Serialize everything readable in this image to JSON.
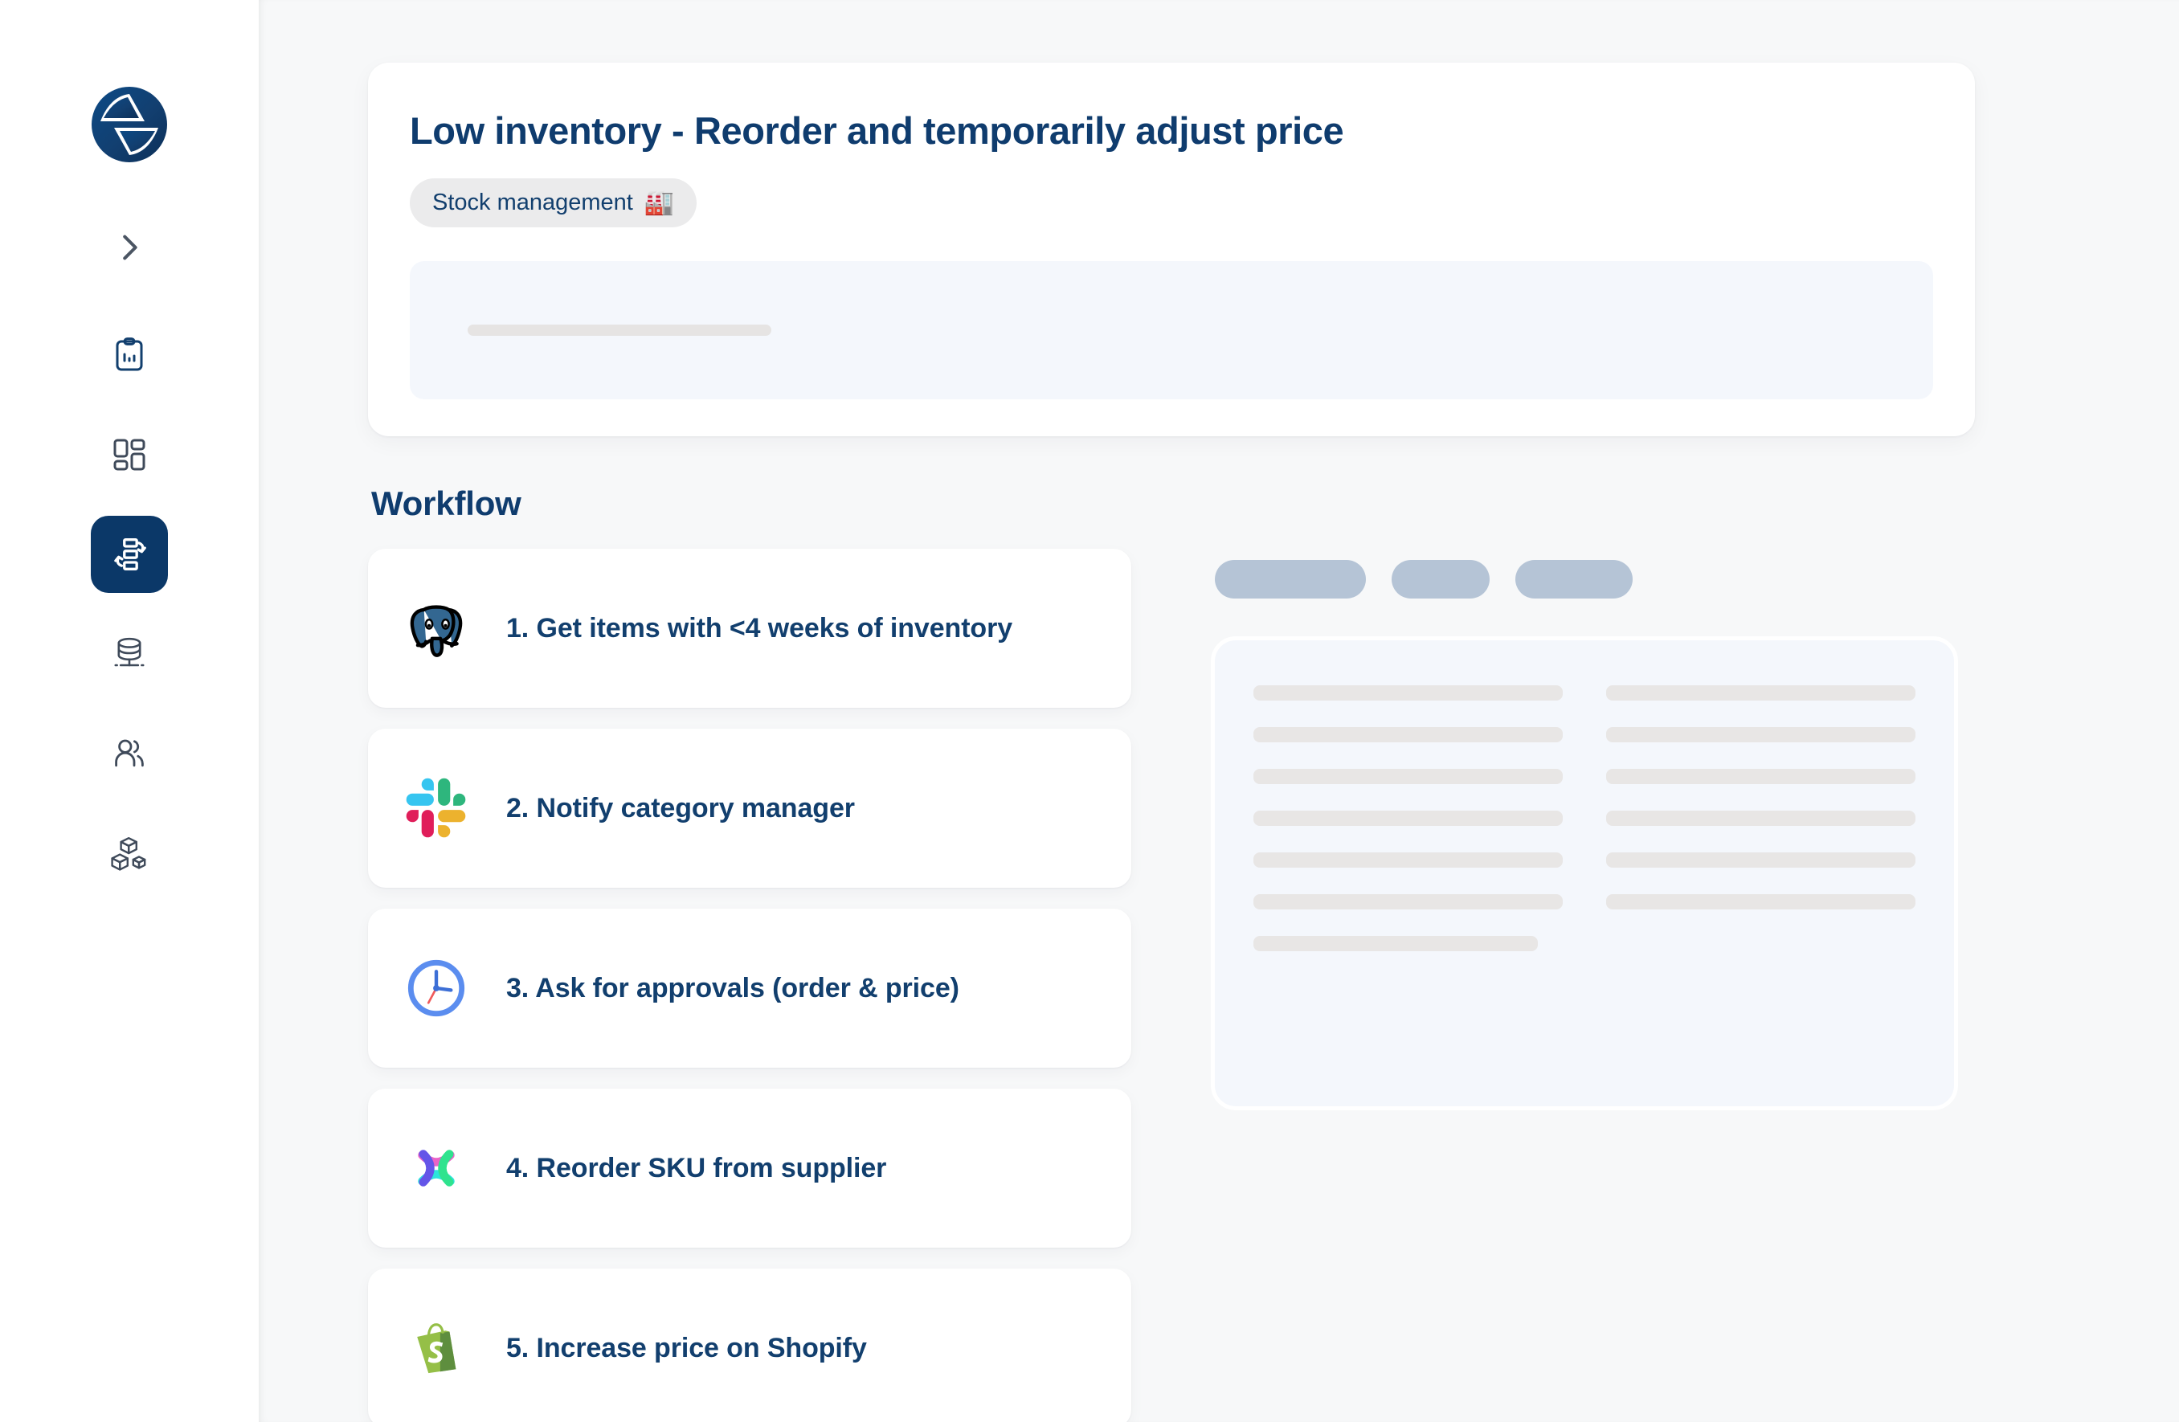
{
  "theme": {
    "brand_navy": "#0b3868",
    "text_navy": "#123f6e",
    "page_bg": "#f7f8f9",
    "card_bg": "#ffffff",
    "skeleton_panel_bg": "#f4f7fc",
    "skeleton_bar": "#e8e6e5",
    "pill_bg": "#ebebec",
    "preview_pill": "#b5c4d6"
  },
  "sidebar": {
    "logo_name": "company-logo",
    "expand": {
      "icon": "chevron-right-icon",
      "label": "Expand navigation"
    },
    "items": [
      {
        "icon": "clipboard-report-icon",
        "name": "reports",
        "active": false
      },
      {
        "icon": "dashboard-grid-icon",
        "name": "dashboards",
        "active": false
      },
      {
        "icon": "workflow-icon",
        "name": "workflows",
        "active": true
      },
      {
        "icon": "database-icon",
        "name": "data",
        "active": false
      },
      {
        "icon": "users-icon",
        "name": "team",
        "active": false
      },
      {
        "icon": "boxes-icon",
        "name": "products",
        "active": false
      }
    ]
  },
  "header": {
    "title": "Low inventory - Reorder and temporarily adjust price",
    "tag": {
      "label": "Stock management",
      "emoji": "🏭"
    }
  },
  "workflow": {
    "section_title": "Workflow",
    "steps": [
      {
        "number": "1.",
        "label": "Get items with <4 weeks of inventory",
        "icon": "postgresql-icon"
      },
      {
        "number": "2.",
        "label": "Notify category manager",
        "icon": "slack-icon"
      },
      {
        "number": "3.",
        "label": "Ask for approvals (order & price)",
        "icon": "clock-icon"
      },
      {
        "number": "4.",
        "label": "Reorder SKU from supplier",
        "icon": "supplier-x-icon"
      },
      {
        "number": "5.",
        "label": "Increase price on Shopify",
        "icon": "shopify-icon"
      }
    ]
  },
  "preview": {
    "pills": [
      {
        "name": "preview-pill-1",
        "width": 142
      },
      {
        "name": "preview-pill-2",
        "width": 92
      },
      {
        "name": "preview-pill-3",
        "width": 110
      }
    ],
    "left_rows": [
      100,
      100,
      100,
      100,
      100,
      100,
      92
    ],
    "right_rows": [
      100,
      100,
      100,
      100,
      100,
      100
    ]
  }
}
